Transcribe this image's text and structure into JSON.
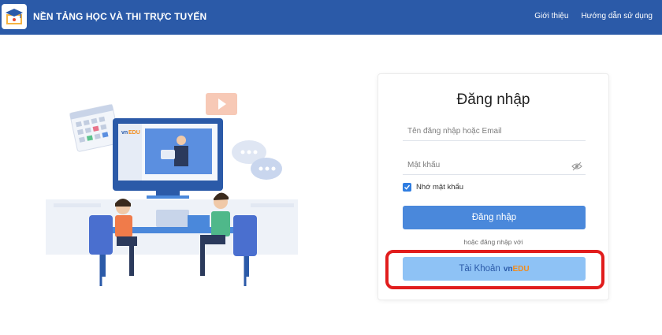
{
  "header": {
    "site_title": "NỀN TẢNG HỌC VÀ THI TRỰC TUYẾN",
    "nav": [
      "Giới thiệu",
      "Hướng dẫn sử dụng"
    ],
    "logo_icon": "school-logo-icon"
  },
  "illustration": {
    "screen_logo": {
      "vn": "vn",
      "edu": "EDU"
    }
  },
  "login": {
    "title": "Đăng nhập",
    "username_placeholder": "Tên đăng nhập hoặc Email",
    "password_placeholder": "Mật khẩu",
    "remember_label": "Nhớ mật khẩu",
    "remember_checked": true,
    "submit_label": "Đăng nhập",
    "or_text": "hoặc đăng nhập với",
    "vnedu_label": "Tài Khoản",
    "vnedu_logo": {
      "vn": "vn",
      "edu": "EDU"
    }
  },
  "colors": {
    "header_bg": "#2b5aa8",
    "primary_button": "#4a88db",
    "secondary_button": "#8ec2f5",
    "highlight": "#e11d1d",
    "edu_orange": "#f28c1b"
  }
}
